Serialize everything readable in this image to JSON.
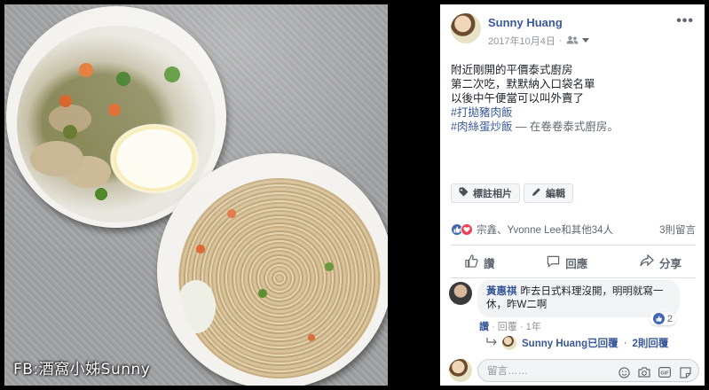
{
  "photo": {
    "watermark": "FB:酒窩小姊Sunny"
  },
  "post": {
    "author": "Sunny Huang",
    "date": "2017年10月4日",
    "privacy_icon": "people-icon",
    "body_lines": [
      "附近剛開的平價泰式廚房",
      "第二次吃，默默納入口袋名單",
      "以後中午便當可以叫外賣了"
    ],
    "hashtag1": "#打拋豬肉飯",
    "hashtag2": "#肉絲蛋炒飯",
    "location_text": "— 在卷卷泰式廚房。",
    "tag_photo_label": "標註相片",
    "edit_label": "編輯"
  },
  "reactions": {
    "names": "宗鑫、Yvonne Lee和其他34人",
    "comment_count": "3則留言"
  },
  "actions": {
    "like": "讚",
    "comment": "回應",
    "share": "分享"
  },
  "comment": {
    "name": "黃惠祺",
    "text": "昨去日式料理沒開，明明就寫一休，昨W二啊",
    "like_count": "2",
    "like_link": "讚",
    "reply_link": "回覆",
    "time": "1年"
  },
  "reply_summary": {
    "name": "Sunny Huang已回覆",
    "count": "2則回覆"
  },
  "composer": {
    "placeholder": "留言……"
  },
  "colors": {
    "link_blue": "#385898",
    "like_blue": "#4267b2",
    "love_red": "#f33e58"
  }
}
